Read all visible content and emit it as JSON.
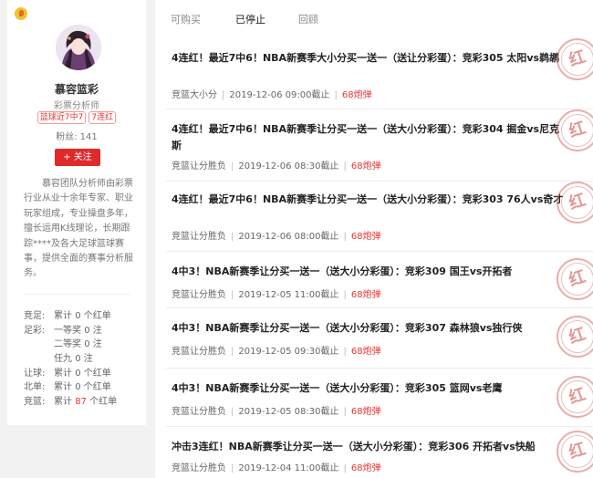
{
  "profile": {
    "name": "慕容篮彩",
    "title": "彩票分析师",
    "tags": [
      "篮球近7中7",
      "7连红"
    ],
    "fans_label": "粉丝:",
    "fans_count": "141",
    "follow_label": "关注",
    "description": "慕容团队分析师由彩票行业从业十余年专家、职业玩家组成，专业操盘多年，擅长运用K线理论，长期跟踪****及各大足球篮球赛事，提供全面的赛事分析服务。"
  },
  "stats": [
    {
      "key": "竞足:",
      "prefix": "累计",
      "value": "0",
      "suffix": "个红单"
    },
    {
      "key": "足彩:",
      "prefix": "一等奖",
      "value": "0",
      "suffix": "注"
    },
    {
      "key": "",
      "prefix": "二等奖",
      "value": "0",
      "suffix": "注"
    },
    {
      "key": "",
      "prefix": "任九",
      "value": "0",
      "suffix": "注"
    },
    {
      "key": "让球:",
      "prefix": "累计",
      "value": "0",
      "suffix": "个红单"
    },
    {
      "key": "北单:",
      "prefix": "累计",
      "value": "0",
      "suffix": "个红单"
    },
    {
      "key": "竞篮:",
      "prefix": "累计",
      "value": "87",
      "suffix": "个红单",
      "highlight": true
    }
  ],
  "tabs": [
    "可购买",
    "已停止",
    "回顾"
  ],
  "active_tab": 1,
  "items": [
    {
      "title": "4连红！最近7中6！NBA新赛季大小分买一送一（送让分彩蛋）：竞彩305 太阳vs鹈鹕",
      "category": "竞篮大小分",
      "datetime": "2019-12-06 09:00截止",
      "price": "68炮弹"
    },
    {
      "title": "4连红！最近7中6！NBA新赛季让分买一送一（送大小分彩蛋）：竞彩304 掘金vs尼克斯",
      "category": "竞篮让分胜负",
      "datetime": "2019-12-06 08:30截止",
      "price": "68炮弹"
    },
    {
      "title": "4连红！最近7中6！NBA新赛季让分买一送一（送大小分彩蛋）：竞彩303 76人vs奇才",
      "category": "竞篮让分胜负",
      "datetime": "2019-12-06 08:00截止",
      "price": "68炮弹"
    },
    {
      "title": "4中3！NBA新赛季让分买一送一（送大小分彩蛋）：竞彩309 国王vs开拓者",
      "category": "竞篮让分胜负",
      "datetime": "2019-12-05 11:00截止",
      "price": "68炮弹"
    },
    {
      "title": "4中3！NBA新赛季让分买一送一（送大小分彩蛋）：竞彩307 森林狼vs独行侠",
      "category": "竞篮让分胜负",
      "datetime": "2019-12-05 09:30截止",
      "price": "68炮弹"
    },
    {
      "title": "4中3！NBA新赛季让分买一送一（送大小分彩蛋）：竞彩305 篮网vs老鹰",
      "category": "竞篮让分胜负",
      "datetime": "2019-12-05 08:30截止",
      "price": "68炮弹"
    },
    {
      "title": "冲击3连红！NBA新赛季让分买一送一（送大小分彩蛋）：竞彩306 开拓者vs快船",
      "category": "竞篮让分胜负",
      "datetime": "2019-12-04 11:00截止",
      "price": "68炮弹"
    }
  ],
  "stamp_text": "红",
  "colors": {
    "accent": "#e02a2a",
    "stamp": "#d66e68",
    "logo": "#f1c232"
  }
}
